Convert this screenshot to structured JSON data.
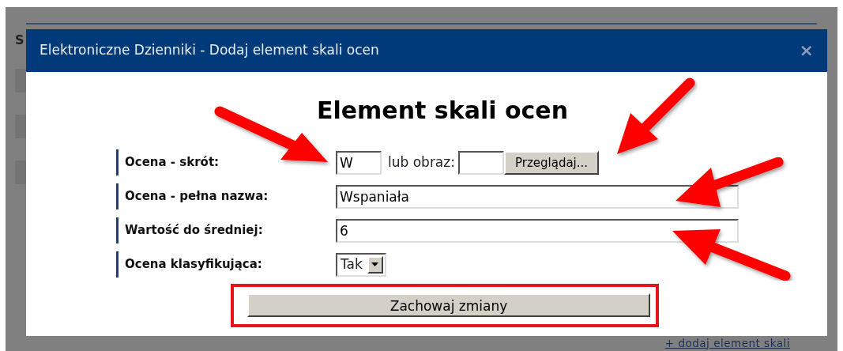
{
  "background_page": {
    "heading_fragment": "S",
    "link": "+ dodaj element skali"
  },
  "dialog": {
    "title": "Elektroniczne Dzienniki - Dodaj element skali ocen",
    "close": "×",
    "heading": "Element skali ocen",
    "fields": [
      {
        "kind": "short-or-image",
        "label": "Ocena - skrót:",
        "value": "W",
        "alt_label": "lub obraz:",
        "browse_button": "Przeglądaj..."
      },
      {
        "kind": "text",
        "label": "Ocena - pełna nazwa:",
        "value": "Wspaniała"
      },
      {
        "kind": "text",
        "label": "Wartość do średniej:",
        "value": "6"
      },
      {
        "kind": "select",
        "label": "Ocena klasyfikująca:",
        "value": "Tak"
      }
    ],
    "submit": "Zachowaj zmiany"
  }
}
